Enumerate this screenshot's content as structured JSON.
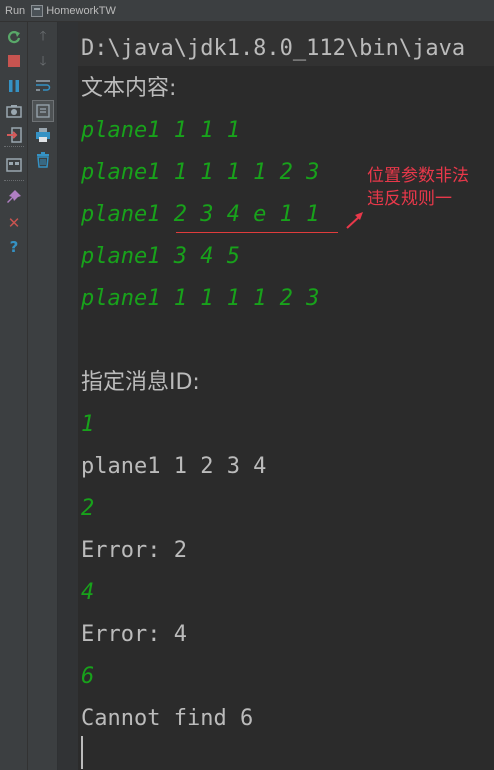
{
  "tab": {
    "run_label": "Run",
    "title": "HomeworkTW"
  },
  "toolbar": {
    "rerun_icon": "rerun-icon",
    "stop_icon": "stop-icon",
    "pause_icon": "pause-icon",
    "dump_icon": "camera-icon",
    "exit_icon": "exit-icon",
    "layout_icon": "layout-icon",
    "pin_icon": "pin-icon",
    "close_icon": "close-icon",
    "help_icon": "help-icon",
    "up_icon": "arrow-up-icon",
    "down_icon": "arrow-down-icon",
    "wrap_icon": "soft-wrap-icon",
    "scroll_end_icon": "scroll-to-end-icon",
    "print_icon": "print-icon",
    "trash_icon": "trash-icon",
    "colors": {
      "rerun": "#59a869",
      "stop": "#c75450",
      "pause": "#3592c4",
      "help": "#3592c4"
    }
  },
  "console": {
    "command": "D:\\java\\jdk1.8.0_112\\bin\\java",
    "content_header": "文本内容:",
    "content_lines": [
      "plane1 1 1 1",
      "plane1 1 1 1 1 2 3",
      "plane1 2 3 4 e 1 1",
      "plane1 3 4 5",
      "plane1 1 1 1 1 2 3"
    ],
    "id_header": "指定消息ID:",
    "outputs": [
      {
        "input": "1",
        "result": "plane1 1 2 3 4"
      },
      {
        "input": "2",
        "result": "Error: 2"
      },
      {
        "input": "4",
        "result": "Error: 4"
      },
      {
        "input": "6",
        "result": "Cannot find 6"
      }
    ]
  },
  "annotation": {
    "line1": "位置参数非法",
    "line2": "违反规则一",
    "color": "#e8384a"
  }
}
